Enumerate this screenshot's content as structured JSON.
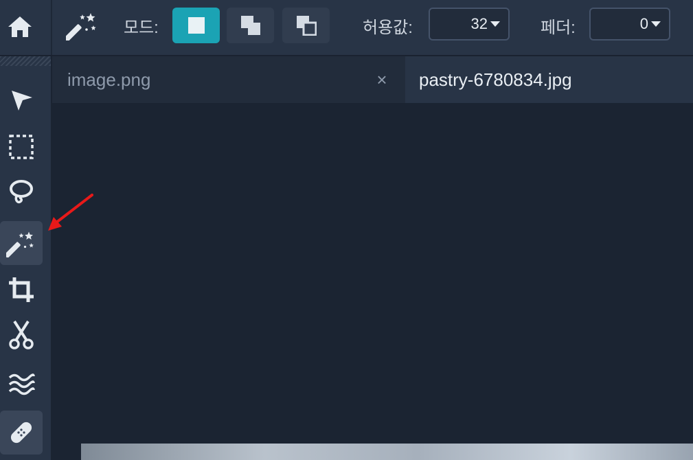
{
  "toolbar": {
    "mode_label": "모드:",
    "tolerance_label": "허용값:",
    "tolerance_value": "32",
    "feather_label": "페더:",
    "feather_value": "0",
    "mode_buttons": [
      "new-selection",
      "add-selection",
      "subtract-selection"
    ],
    "active_mode": "new-selection"
  },
  "tabs": [
    {
      "label": "image.png",
      "active": false
    },
    {
      "label": "pastry-6780834.jpg",
      "active": true
    }
  ],
  "tab_close_glyph": "×",
  "sidebar": {
    "tools": [
      "select-arrow-icon",
      "rect-marquee-icon",
      "lasso-icon",
      "magic-wand-icon",
      "crop-icon",
      "scissors-icon",
      "liquify-wave-icon",
      "bandage-heal-icon"
    ],
    "active_tool": "magic-wand-icon"
  },
  "colors": {
    "accent": "#1ba3b4",
    "annotation": "#e81919",
    "icon": "#e6ebf0"
  }
}
